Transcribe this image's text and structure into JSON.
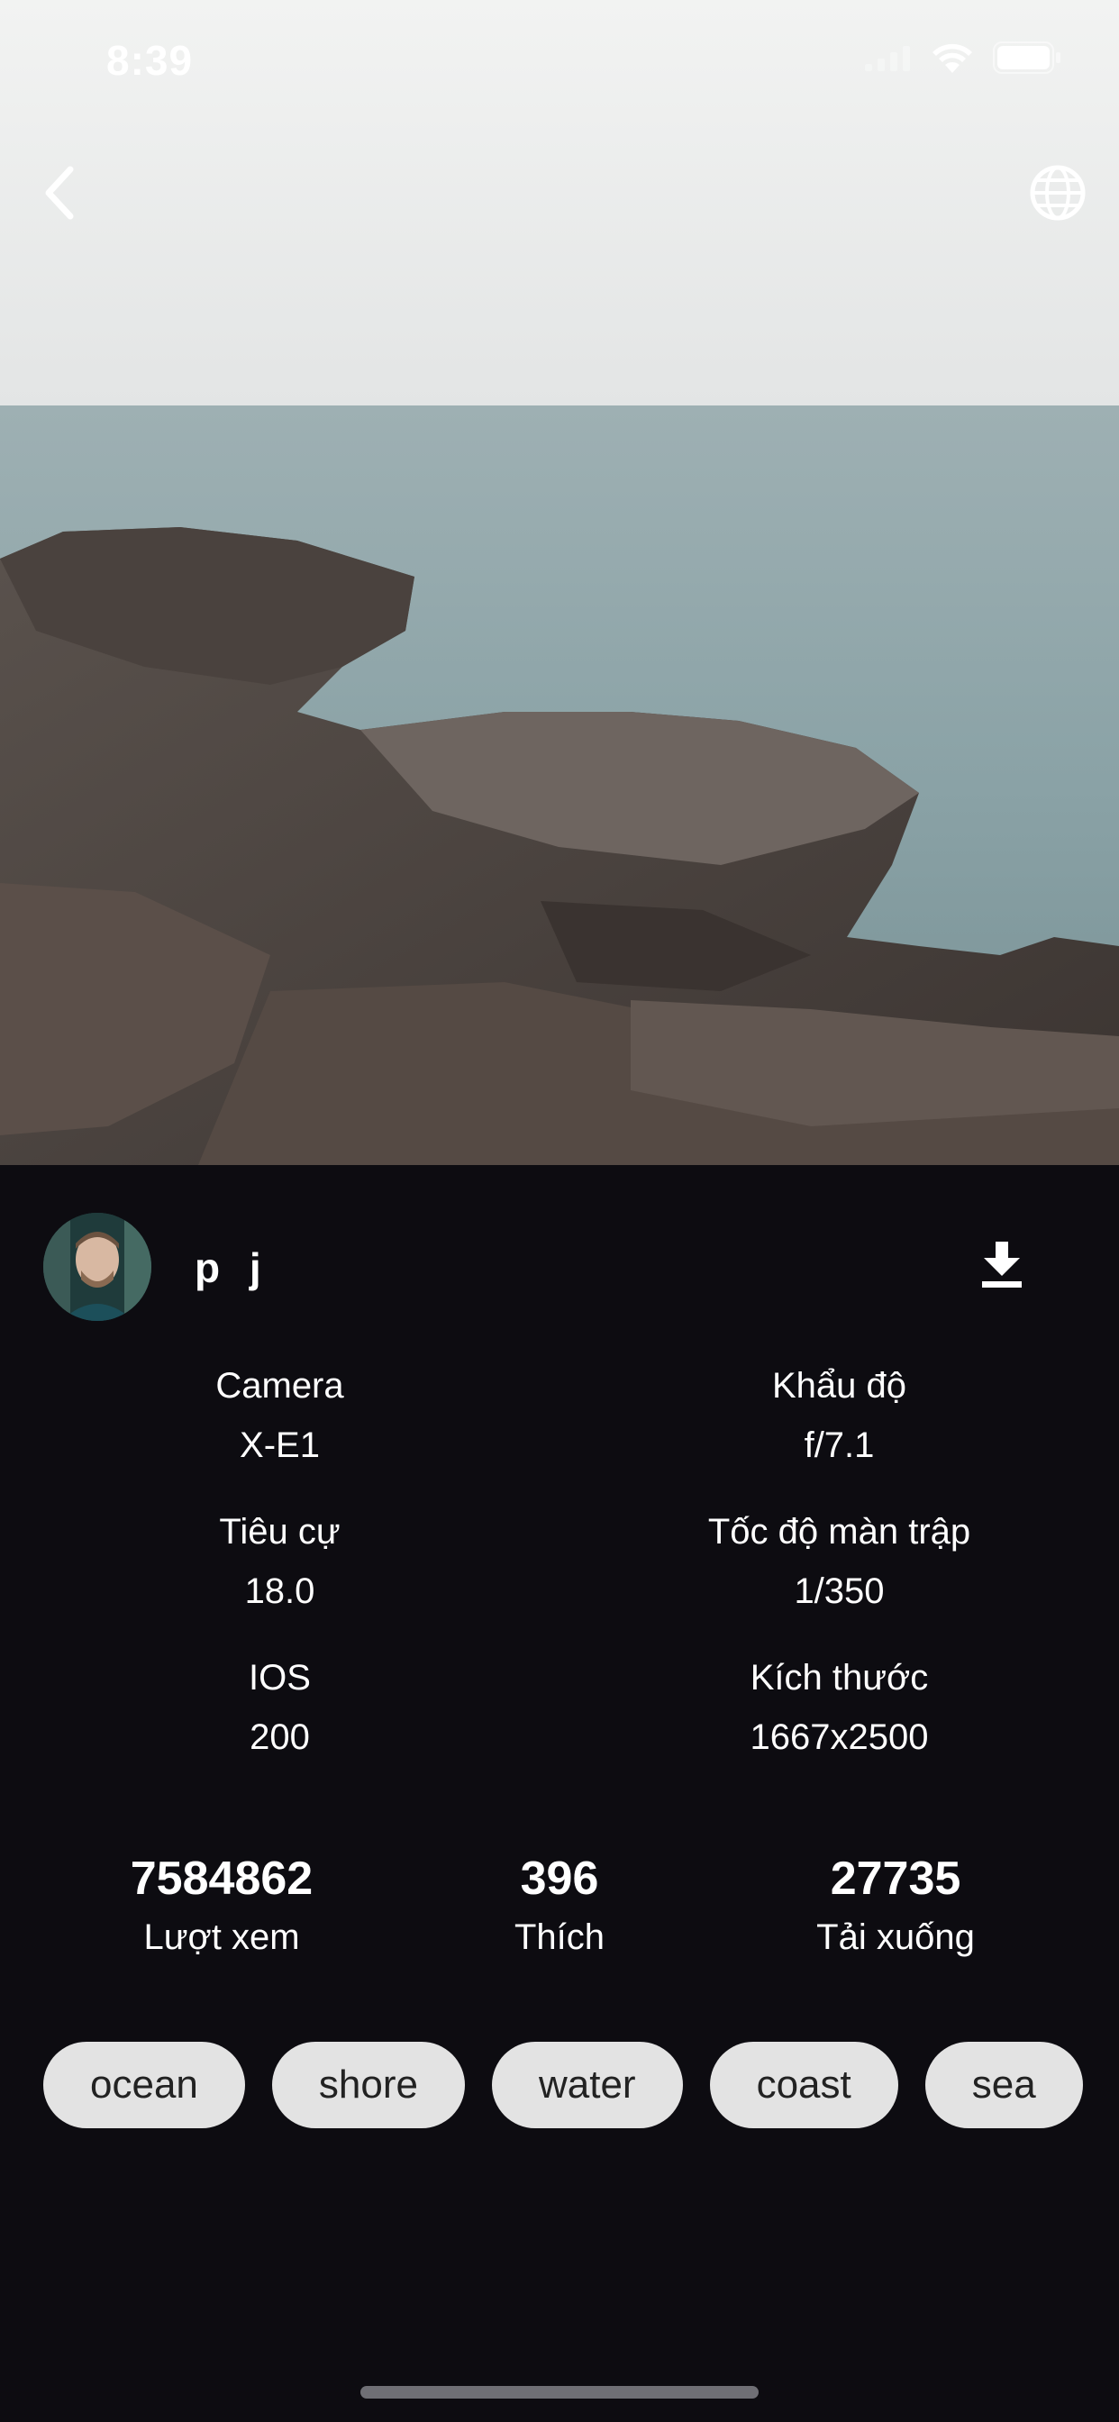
{
  "status_bar": {
    "time": "8:39"
  },
  "photo": {
    "description_icon": "seascape-photo"
  },
  "nav": {
    "back_icon": "chevron-left-icon",
    "globe_icon": "globe-icon"
  },
  "author": {
    "name": "p j",
    "download_icon": "download-icon"
  },
  "exif": [
    {
      "label": "Camera",
      "value": "X-E1"
    },
    {
      "label": "Khẩu độ",
      "value": "f/7.1"
    },
    {
      "label": "Tiêu cự",
      "value": "18.0"
    },
    {
      "label": "Tốc độ màn trập",
      "value": "1/350"
    },
    {
      "label": "IOS",
      "value": "200"
    },
    {
      "label": "Kích thước",
      "value": "1667x2500"
    }
  ],
  "stats": [
    {
      "value": "7584862",
      "label": "Lượt xem"
    },
    {
      "value": "396",
      "label": "Thích"
    },
    {
      "value": "27735",
      "label": "Tải xuống"
    }
  ],
  "tags": [
    "ocean",
    "shore",
    "water",
    "coast",
    "sea"
  ],
  "colors": {
    "background": "#0d0c11",
    "tag_bg": "#e3e3e3",
    "tag_text": "#222222"
  }
}
